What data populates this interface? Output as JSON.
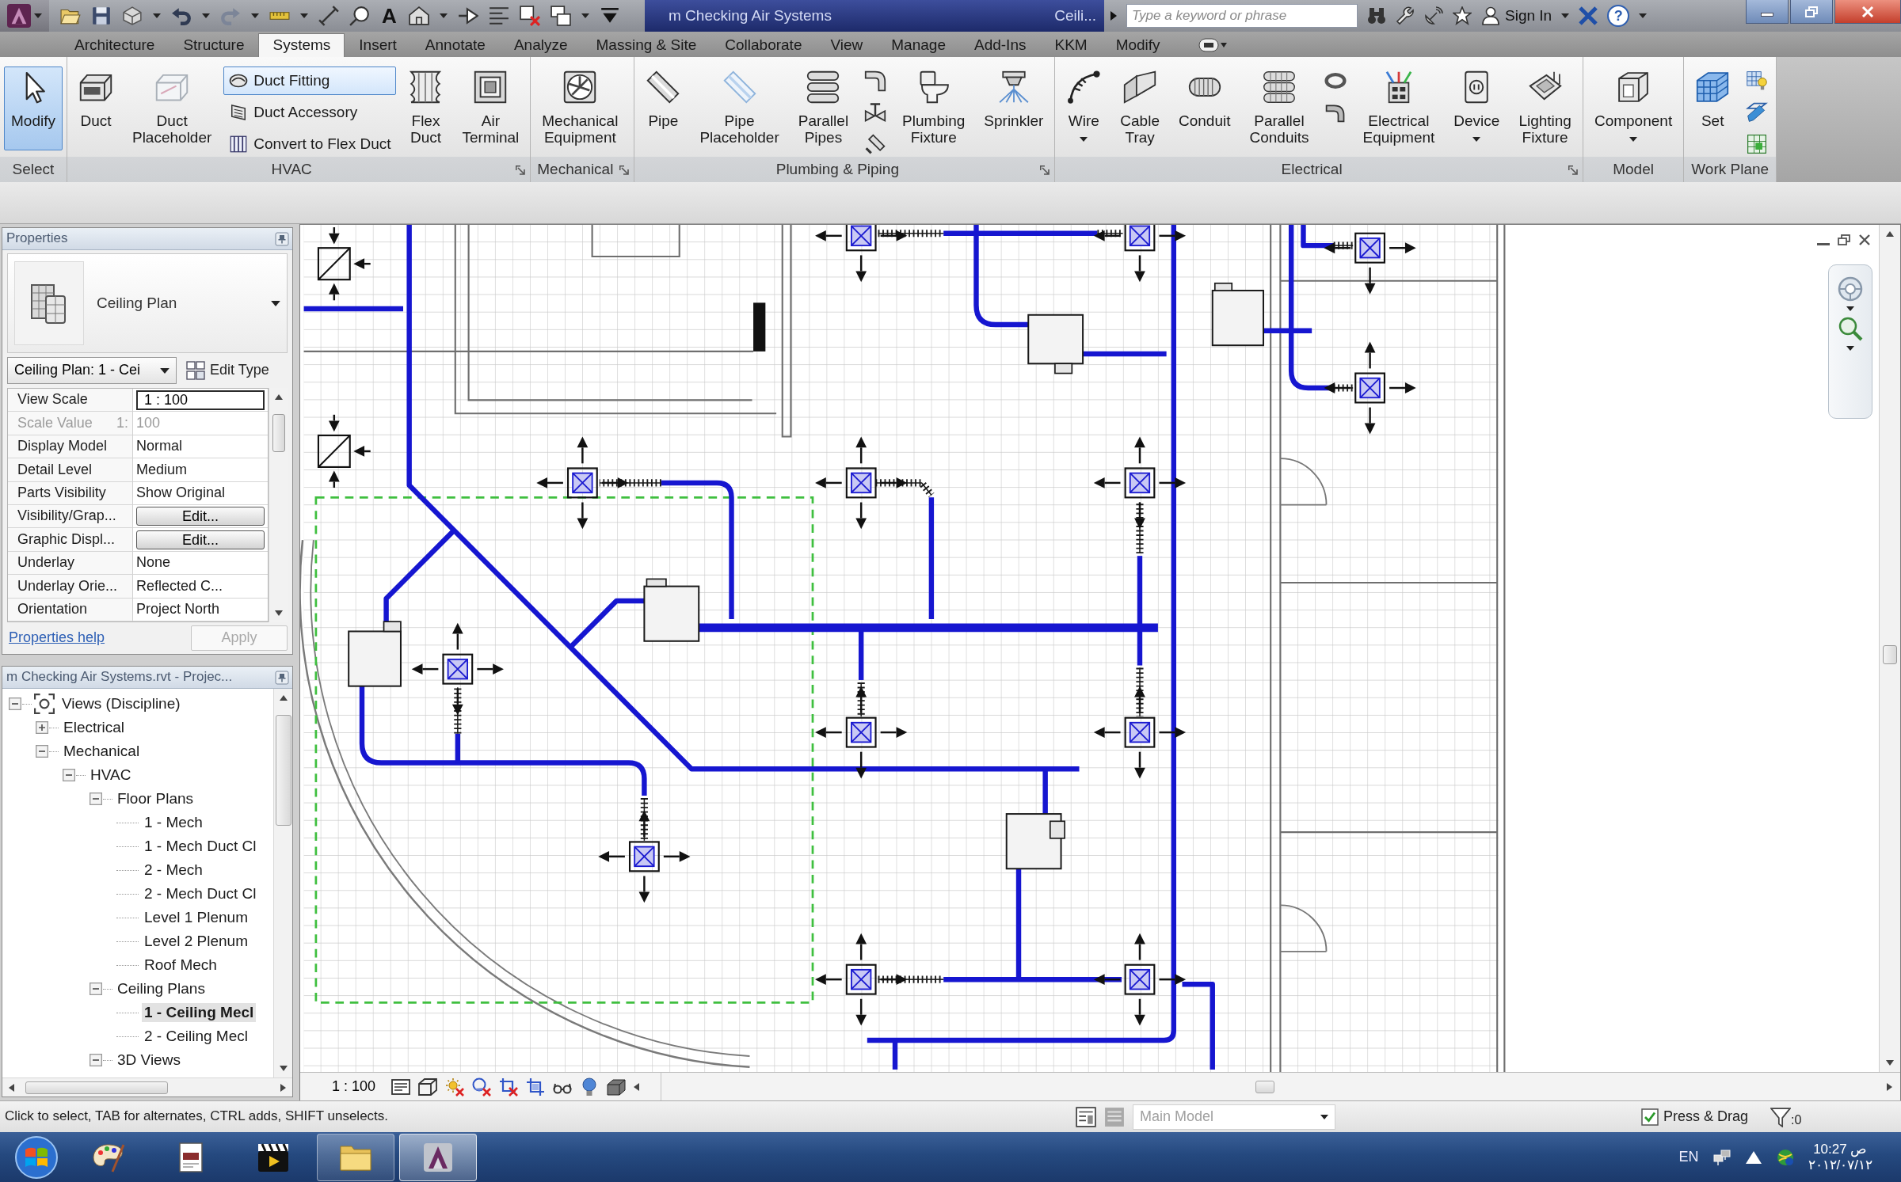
{
  "title_bar": {
    "title_parts": [
      "m Checking Air Systems",
      "Ceili..."
    ],
    "text_tool_glyph": "A",
    "search": {
      "placeholder": "Type a keyword or phrase"
    },
    "sign_in": "Sign In",
    "help_glyph": "?"
  },
  "ribbon": {
    "tabs": [
      {
        "label": "Architecture",
        "selected": false
      },
      {
        "label": "Structure",
        "selected": false
      },
      {
        "label": "Systems",
        "selected": true
      },
      {
        "label": "Insert",
        "selected": false
      },
      {
        "label": "Annotate",
        "selected": false
      },
      {
        "label": "Analyze",
        "selected": false
      },
      {
        "label": "Massing & Site",
        "selected": false
      },
      {
        "label": "Collaborate",
        "selected": false
      },
      {
        "label": "View",
        "selected": false
      },
      {
        "label": "Manage",
        "selected": false
      },
      {
        "label": "Add-Ins",
        "selected": false
      },
      {
        "label": "KKM",
        "selected": false
      },
      {
        "label": "Modify",
        "selected": false
      }
    ],
    "panels": [
      {
        "label": "Select",
        "launcher": false,
        "tools": [
          {
            "kind": "large",
            "label": "Modify",
            "pressed": true,
            "hovered": false
          }
        ]
      },
      {
        "label": "HVAC",
        "launcher": true,
        "tools": [
          {
            "kind": "large",
            "label": "Duct",
            "pressed": false,
            "hovered": false
          },
          {
            "kind": "large",
            "label": "Duct Placeholder",
            "pressed": false,
            "hovered": false
          },
          {
            "kind": "small",
            "label": "Duct Fitting",
            "pressed": false,
            "hovered": true
          },
          {
            "kind": "small",
            "label": "Duct Accessory",
            "pressed": false,
            "hovered": false
          },
          {
            "kind": "small",
            "label": "Convert to Flex Duct",
            "pressed": false,
            "hovered": false
          },
          {
            "kind": "large",
            "label": "Flex Duct",
            "pressed": false,
            "hovered": false
          },
          {
            "kind": "large",
            "label": "Air Terminal",
            "pressed": false,
            "hovered": false
          }
        ]
      },
      {
        "label": "Mechanical",
        "launcher": true,
        "tools": [
          {
            "kind": "large",
            "label": "Mechanical Equipment",
            "pressed": false,
            "hovered": false
          }
        ]
      },
      {
        "label": "Plumbing & Piping",
        "launcher": true,
        "tools": [
          {
            "kind": "large",
            "label": "Pipe",
            "pressed": false,
            "hovered": false
          },
          {
            "kind": "large",
            "label": "Pipe Placeholder",
            "pressed": false,
            "hovered": false
          },
          {
            "kind": "large",
            "label": "Parallel Pipes",
            "pressed": false,
            "hovered": false
          },
          {
            "kind": "icon",
            "pressed": false,
            "hovered": false
          },
          {
            "kind": "icon",
            "pressed": false,
            "hovered": false
          },
          {
            "kind": "icon",
            "pressed": false,
            "hovered": false
          },
          {
            "kind": "large",
            "label": "Plumbing Fixture",
            "pressed": false,
            "hovered": false
          },
          {
            "kind": "large",
            "label": "Sprinkler",
            "pressed": false,
            "hovered": false
          }
        ]
      },
      {
        "label": "Electrical",
        "launcher": true,
        "tools": [
          {
            "kind": "large",
            "label": "Wire",
            "dropdown": true,
            "pressed": false,
            "hovered": false
          },
          {
            "kind": "large",
            "label": "Cable Tray",
            "pressed": false,
            "hovered": false
          },
          {
            "kind": "large",
            "label": "Conduit",
            "pressed": false,
            "hovered": false
          },
          {
            "kind": "large",
            "label": "Parallel Conduits",
            "pressed": false,
            "hovered": false
          },
          {
            "kind": "icon",
            "pressed": false,
            "hovered": false
          },
          {
            "kind": "icon",
            "pressed": false,
            "hovered": false
          },
          {
            "kind": "large",
            "label": "Electrical Equipment",
            "pressed": false,
            "hovered": false
          },
          {
            "kind": "large",
            "label": "Device",
            "dropdown": true,
            "pressed": false,
            "hovered": false
          },
          {
            "kind": "large",
            "label": "Lighting Fixture",
            "pressed": false,
            "hovered": false
          }
        ]
      },
      {
        "label": "Model",
        "launcher": false,
        "tools": [
          {
            "kind": "large",
            "label": "Component",
            "dropdown": true,
            "pressed": false,
            "hovered": false
          }
        ]
      },
      {
        "label": "Work Plane",
        "launcher": false,
        "tools": [
          {
            "kind": "large",
            "label": "Set",
            "pressed": false,
            "hovered": false
          },
          {
            "kind": "icon",
            "pressed": false,
            "hovered": false
          },
          {
            "kind": "icon",
            "pressed": false,
            "hovered": false
          },
          {
            "kind": "icon",
            "pressed": false,
            "hovered": false
          }
        ]
      }
    ]
  },
  "properties": {
    "title": "Properties",
    "type_name": "Ceiling Plan",
    "instance": "Ceiling Plan: 1 - Cei",
    "edit_type": "Edit Type",
    "rows": [
      {
        "kind": "input",
        "name": "View Scale",
        "value": "1 : 100"
      },
      {
        "kind": "readonly",
        "name": "Scale Value",
        "unit": "1:",
        "value": "100"
      },
      {
        "kind": "text",
        "name": "Display Model",
        "value": "Normal"
      },
      {
        "kind": "text",
        "name": "Detail Level",
        "value": "Medium"
      },
      {
        "kind": "text",
        "name": "Parts Visibility",
        "value": "Show Original"
      },
      {
        "kind": "button",
        "name": "Visibility/Grap...",
        "value": "Edit..."
      },
      {
        "kind": "button",
        "name": "Graphic Displ...",
        "value": "Edit..."
      },
      {
        "kind": "text",
        "name": "Underlay",
        "value": "None"
      },
      {
        "kind": "text",
        "name": "Underlay Orie...",
        "value": "Reflected C..."
      },
      {
        "kind": "text",
        "name": "Orientation",
        "value": "Project North"
      }
    ],
    "help_link": "Properties help",
    "apply": {
      "label": "Apply",
      "disabled": true
    }
  },
  "project_browser": {
    "title": "m Checking Air Systems.rvt - Projec...",
    "tree": [
      {
        "label": "Views (Discipline)",
        "expanded": true,
        "selected": false,
        "children": [
          {
            "label": "Electrical",
            "expanded": false,
            "selected": false
          },
          {
            "label": "Mechanical",
            "expanded": true,
            "selected": false,
            "children": [
              {
                "label": "HVAC",
                "expanded": true,
                "selected": false,
                "children": [
                  {
                    "label": "Floor Plans",
                    "expanded": true,
                    "selected": false,
                    "children": [
                      {
                        "label": "1 - Mech",
                        "selected": false
                      },
                      {
                        "label": "1 - Mech Duct Cl",
                        "selected": false
                      },
                      {
                        "label": "2 - Mech",
                        "selected": false
                      },
                      {
                        "label": "2 - Mech Duct Cl",
                        "selected": false
                      },
                      {
                        "label": "Level 1 Plenum",
                        "selected": false
                      },
                      {
                        "label": "Level 2 Plenum",
                        "selected": false
                      },
                      {
                        "label": "Roof Mech",
                        "selected": false
                      }
                    ]
                  },
                  {
                    "label": "Ceiling Plans",
                    "expanded": true,
                    "selected": false,
                    "children": [
                      {
                        "label": "1 - Ceiling Mecl",
                        "selected": true
                      },
                      {
                        "label": "2 - Ceiling Mecl",
                        "selected": false
                      }
                    ]
                  },
                  {
                    "label": "3D Views",
                    "expanded": true,
                    "selected": false
                  }
                ]
              }
            ]
          }
        ]
      }
    ]
  },
  "view": {
    "scale": "1 : 100"
  },
  "status_bar": {
    "message": "Click to select, TAB for alternates, CTRL adds, SHIFT unselects.",
    "workset": {
      "value": "Main Model",
      "disabled": true
    },
    "press_drag": {
      "label": "Press & Drag",
      "checked": true
    },
    "filter_count": ":0"
  },
  "taskbar": {
    "apps": [
      {
        "kind": "paint",
        "running": false,
        "selected": false
      },
      {
        "kind": "notepad",
        "running": false,
        "selected": false
      },
      {
        "kind": "media",
        "running": false,
        "selected": false
      },
      {
        "kind": "folder",
        "running": true,
        "selected": false
      },
      {
        "kind": "cad",
        "running": true,
        "selected": true
      }
    ],
    "language": "EN",
    "time": "10:27 ص",
    "date": "٢٠١٢/٠٧/١٢"
  }
}
